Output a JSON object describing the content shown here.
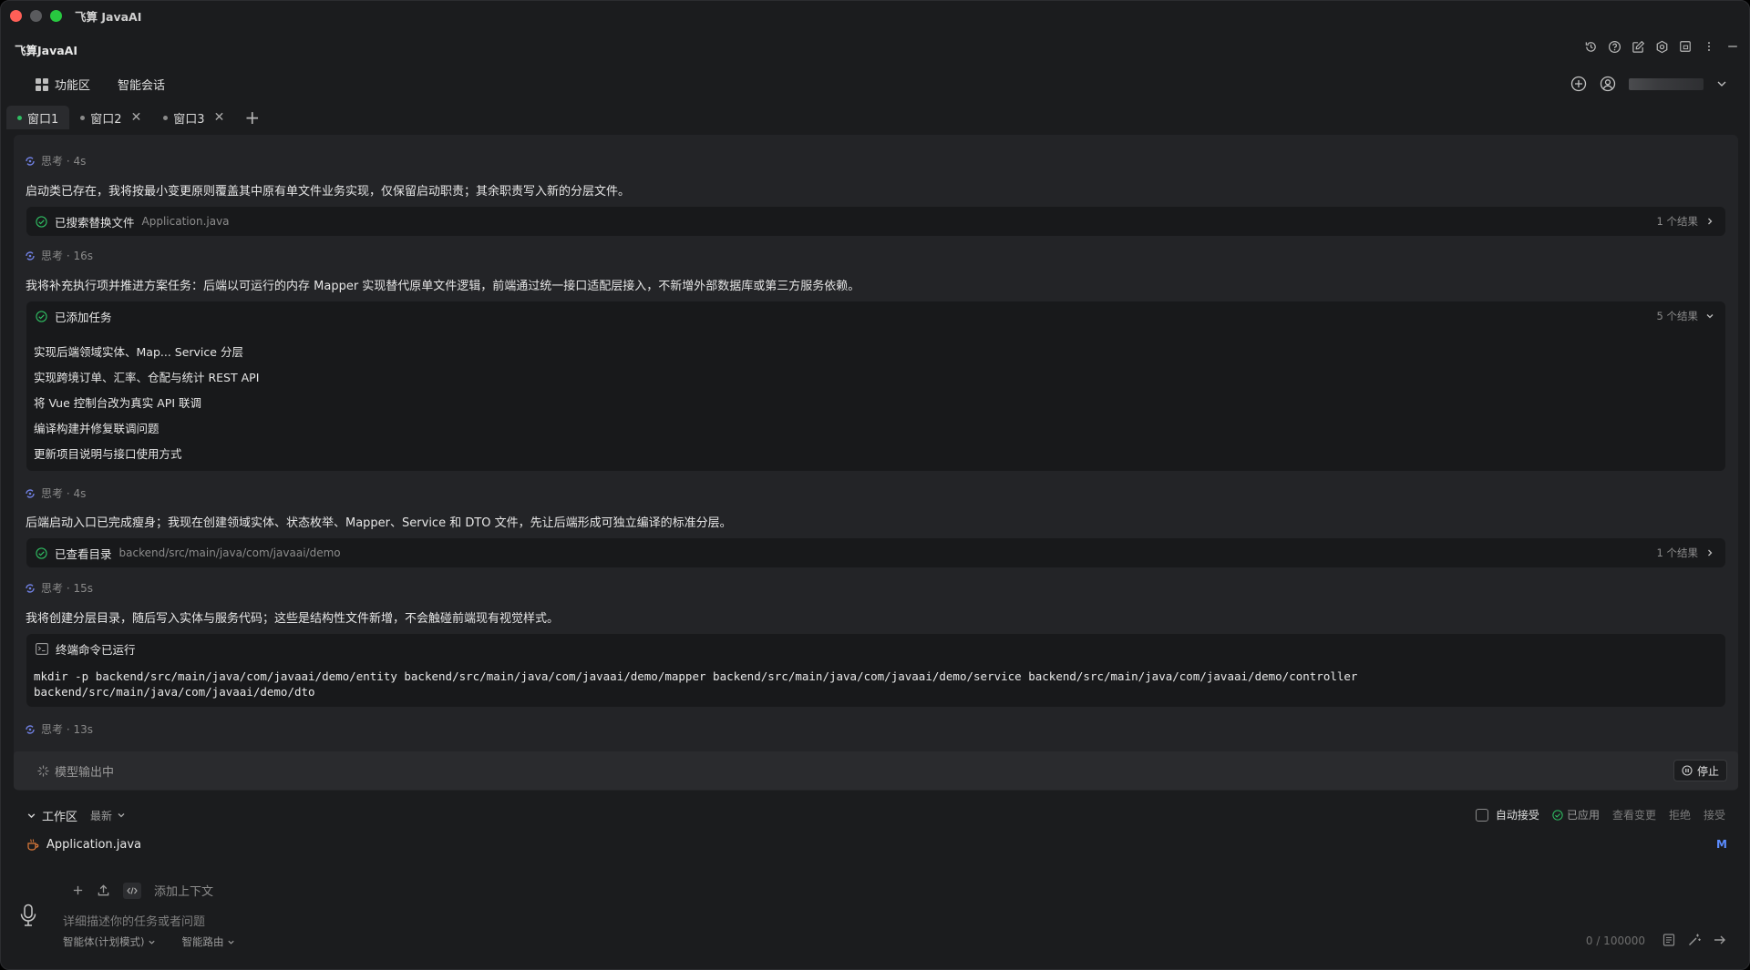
{
  "window": {
    "title": "飞算 JavaAI"
  },
  "app": {
    "name": "飞算JavaAI"
  },
  "nav": {
    "items": [
      {
        "label": "功能区"
      },
      {
        "label": "智能会话"
      }
    ]
  },
  "tabs": [
    {
      "label": "窗口1"
    },
    {
      "label": "窗口2"
    },
    {
      "label": "窗口3"
    }
  ],
  "chat": {
    "think1": "思考 · 4s",
    "msg1": "启动类已存在，我将按最小变更原则覆盖其中原有单文件业务实现，仅保留启动职责；其余职责写入新的分层文件。",
    "card1": {
      "title": "已搜索替换文件",
      "sub": "Application.java",
      "result": "1 个结果"
    },
    "think2": "思考 · 16s",
    "msg2": "我将补充执行项并推进方案任务：后端以可运行的内存 Mapper 实现替代原单文件逻辑，前端通过统一接口适配层接入，不新增外部数据库或第三方服务依赖。",
    "card2": {
      "title": "已添加任务",
      "result": "5 个结果",
      "tasks": [
        "实现后端领域实体、Map... Service 分层",
        "实现跨境订单、汇率、仓配与统计 REST API",
        "将 Vue 控制台改为真实 API 联调",
        "编译构建并修复联调问题",
        "更新项目说明与接口使用方式"
      ]
    },
    "think3": "思考 · 4s",
    "msg3": "后端启动入口已完成瘦身；我现在创建领域实体、状态枚举、Mapper、Service 和 DTO 文件，先让后端形成可独立编译的标准分层。",
    "card3": {
      "title": "已查看目录",
      "sub": "backend/src/main/java/com/javaai/demo",
      "result": "1 个结果"
    },
    "think4": "思考 · 15s",
    "msg4": "我将创建分层目录，随后写入实体与服务代码；这些是结构性文件新增，不会触碰前端现有视觉样式。",
    "card4": {
      "title": "终端命令已运行",
      "cmd_line1": "mkdir -p backend/src/main/java/com/javaai/demo/entity backend/src/main/java/com/javaai/demo/mapper backend/src/main/java/com/javaai/demo/service backend/src/main/java/com/javaai/demo/controller",
      "cmd_line2": "backend/src/main/java/com/javaai/demo/dto"
    },
    "think5": "思考 · 13s"
  },
  "status": {
    "text": "模型输出中",
    "stop": "停止"
  },
  "workspace": {
    "title": "工作区",
    "filter": "最新",
    "auto_accept": "自动接受",
    "applied": "已应用",
    "view_changes": "查看变更",
    "reject": "拒绝",
    "accept": "接受",
    "file": "Application.java",
    "file_status": "M"
  },
  "input": {
    "add_context": "添加上下文",
    "placeholder": "详细描述你的任务或者问题",
    "agent_mode": "智能体(计划模式)",
    "routing": "智能路由",
    "counter": "0 / 100000"
  },
  "colors": {
    "accent_green": "#2fbd62",
    "accent_blue": "#5b8cff",
    "think_icon": "#6f7fe0"
  }
}
